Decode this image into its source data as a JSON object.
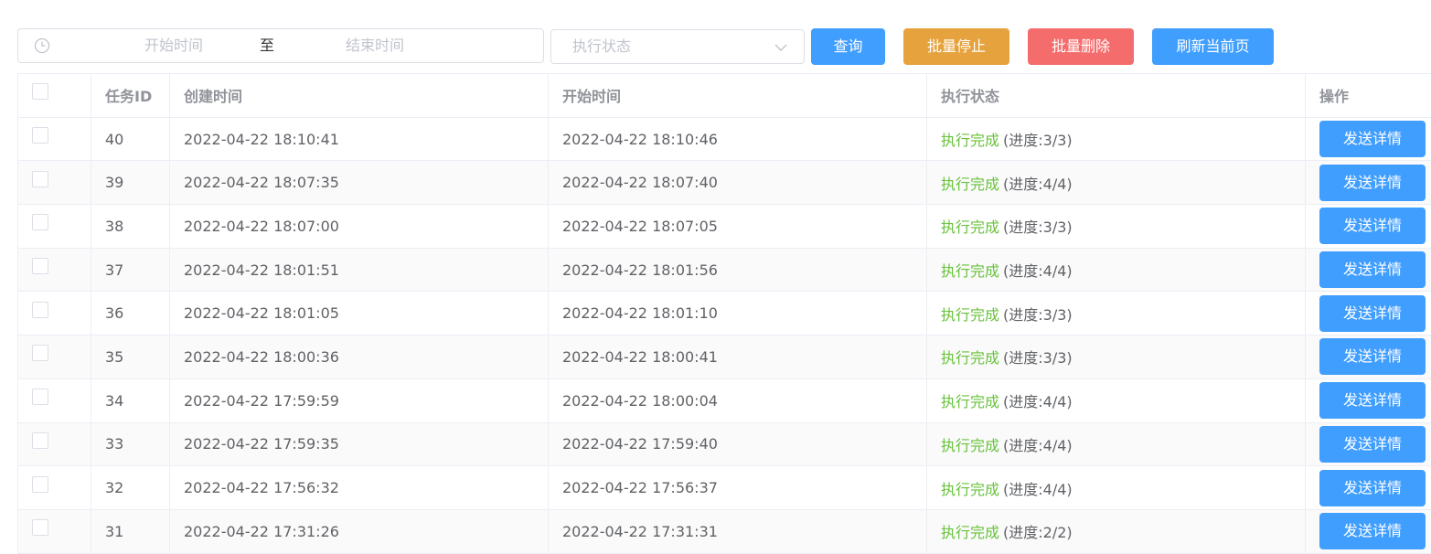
{
  "filters": {
    "date_start_placeholder": "开始时间",
    "date_separator": "至",
    "date_end_placeholder": "结束时间",
    "status_placeholder": "执行状态"
  },
  "toolbar": {
    "query_label": "查询",
    "batch_stop_label": "批量停止",
    "batch_delete_label": "批量删除",
    "refresh_label": "刷新当前页"
  },
  "colors": {
    "primary": "#409eff",
    "warning": "#e6a23c",
    "danger": "#f56c6c",
    "success": "#67c23a"
  },
  "table": {
    "headers": {
      "task_id": "任务ID",
      "created_at": "创建时间",
      "started_at": "开始时间",
      "status": "执行状态",
      "action": "操作"
    },
    "rows": [
      {
        "id": "40",
        "created": "2022-04-22 18:10:41",
        "started": "2022-04-22 18:10:46",
        "status": "执行完成",
        "progress": "(进度:3/3)",
        "action": "发送详情"
      },
      {
        "id": "39",
        "created": "2022-04-22 18:07:35",
        "started": "2022-04-22 18:07:40",
        "status": "执行完成",
        "progress": "(进度:4/4)",
        "action": "发送详情"
      },
      {
        "id": "38",
        "created": "2022-04-22 18:07:00",
        "started": "2022-04-22 18:07:05",
        "status": "执行完成",
        "progress": "(进度:3/3)",
        "action": "发送详情"
      },
      {
        "id": "37",
        "created": "2022-04-22 18:01:51",
        "started": "2022-04-22 18:01:56",
        "status": "执行完成",
        "progress": "(进度:4/4)",
        "action": "发送详情"
      },
      {
        "id": "36",
        "created": "2022-04-22 18:01:05",
        "started": "2022-04-22 18:01:10",
        "status": "执行完成",
        "progress": "(进度:3/3)",
        "action": "发送详情"
      },
      {
        "id": "35",
        "created": "2022-04-22 18:00:36",
        "started": "2022-04-22 18:00:41",
        "status": "执行完成",
        "progress": "(进度:3/3)",
        "action": "发送详情"
      },
      {
        "id": "34",
        "created": "2022-04-22 17:59:59",
        "started": "2022-04-22 18:00:04",
        "status": "执行完成",
        "progress": "(进度:4/4)",
        "action": "发送详情"
      },
      {
        "id": "33",
        "created": "2022-04-22 17:59:35",
        "started": "2022-04-22 17:59:40",
        "status": "执行完成",
        "progress": "(进度:4/4)",
        "action": "发送详情"
      },
      {
        "id": "32",
        "created": "2022-04-22 17:56:32",
        "started": "2022-04-22 17:56:37",
        "status": "执行完成",
        "progress": "(进度:4/4)",
        "action": "发送详情"
      },
      {
        "id": "31",
        "created": "2022-04-22 17:31:26",
        "started": "2022-04-22 17:31:31",
        "status": "执行完成",
        "progress": "(进度:2/2)",
        "action": "发送详情"
      }
    ]
  }
}
